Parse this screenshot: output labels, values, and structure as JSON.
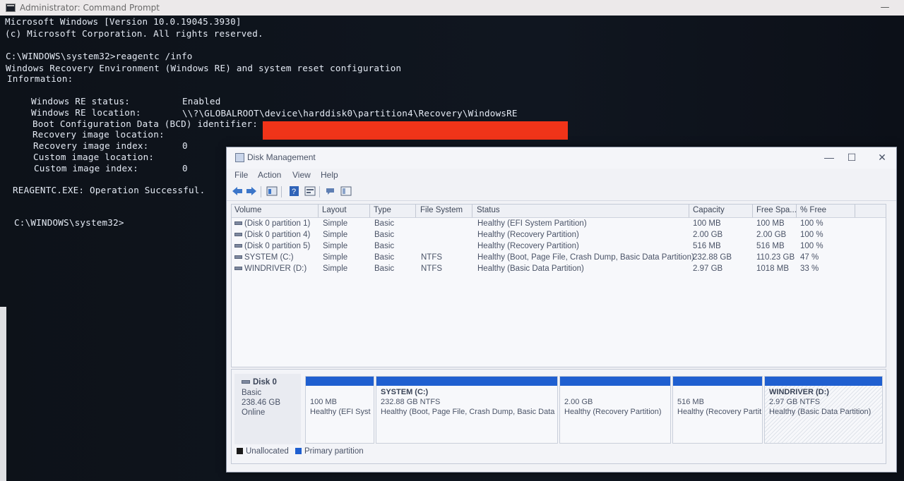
{
  "cmd": {
    "title": "Administrator: Command Prompt",
    "lines": [
      "Microsoft Windows [Version 10.0.19045.3930]",
      "(c) Microsoft Corporation. All rights reserved.",
      "C:\\WINDOWS\\system32>reagentc /info",
      "Windows Recovery Environment (Windows RE) and system reset configuration",
      "Information:",
      "Windows RE status:",
      "Enabled",
      "Windows RE location:",
      "\\\\?\\GLOBALROOT\\device\\harddisk0\\partition4\\Recovery\\WindowsRE",
      "Boot Configuration Data (BCD) identifier:",
      "Recovery image location:",
      "Recovery image index:",
      "0",
      "Custom image location:",
      "Custom image index:",
      "0",
      "REAGENTC.EXE: Operation Successful.",
      "C:\\WINDOWS\\system32>"
    ],
    "redaction_color": "#f03419"
  },
  "dm": {
    "title": "Disk Management",
    "window_buttons": [
      "—",
      "☐",
      "✕"
    ],
    "menu": [
      "File",
      "Action",
      "View",
      "Help"
    ],
    "toolbar_icons": [
      "back-arrow-icon",
      "forward-arrow-icon",
      "disk-list-icon",
      "help-icon",
      "properties-icon",
      "rescan-icon",
      "console-tree-icon"
    ],
    "columns": [
      "Volume",
      "Layout",
      "Type",
      "File System",
      "Status",
      "Capacity",
      "Free Spa...",
      "% Free"
    ],
    "rows": [
      {
        "volume": "(Disk 0 partition 1)",
        "layout": "Simple",
        "type": "Basic",
        "fs": "",
        "status": "Healthy (EFI System Partition)",
        "capacity": "100 MB",
        "free": "100 MB",
        "pct": "100 %"
      },
      {
        "volume": "(Disk 0 partition 4)",
        "layout": "Simple",
        "type": "Basic",
        "fs": "",
        "status": "Healthy (Recovery Partition)",
        "capacity": "2.00 GB",
        "free": "2.00 GB",
        "pct": "100 %"
      },
      {
        "volume": "(Disk 0 partition 5)",
        "layout": "Simple",
        "type": "Basic",
        "fs": "",
        "status": "Healthy (Recovery Partition)",
        "capacity": "516 MB",
        "free": "516 MB",
        "pct": "100 %"
      },
      {
        "volume": "SYSTEM (C:)",
        "layout": "Simple",
        "type": "Basic",
        "fs": "NTFS",
        "status": "Healthy (Boot, Page File, Crash Dump, Basic Data Partition)",
        "capacity": "232.88 GB",
        "free": "110.23 GB",
        "pct": "47 %"
      },
      {
        "volume": "WINDRIVER (D:)",
        "layout": "Simple",
        "type": "Basic",
        "fs": "NTFS",
        "status": "Healthy (Basic Data Partition)",
        "capacity": "2.97 GB",
        "free": "1018 MB",
        "pct": "33 %"
      }
    ],
    "disk": {
      "name": "Disk 0",
      "type": "Basic",
      "size": "238.46 GB",
      "state": "Online",
      "partitions": [
        {
          "name": "",
          "size": "100 MB",
          "status": "Healthy (EFI Syst"
        },
        {
          "name": "SYSTEM  (C:)",
          "size": "232.88 GB NTFS",
          "status": "Healthy (Boot, Page File, Crash Dump, Basic Data F"
        },
        {
          "name": "",
          "size": "2.00 GB",
          "status": "Healthy (Recovery Partition)"
        },
        {
          "name": "",
          "size": "516 MB",
          "status": "Healthy (Recovery Partit"
        },
        {
          "name": "WINDRIVER  (D:)",
          "size": "2.97 GB NTFS",
          "status": "Healthy (Basic Data Partition)"
        }
      ]
    },
    "legend": {
      "unallocated": "Unallocated",
      "primary": "Primary partition",
      "unallocated_color": "#1a1a1a",
      "primary_color": "#1f5fd0"
    }
  }
}
